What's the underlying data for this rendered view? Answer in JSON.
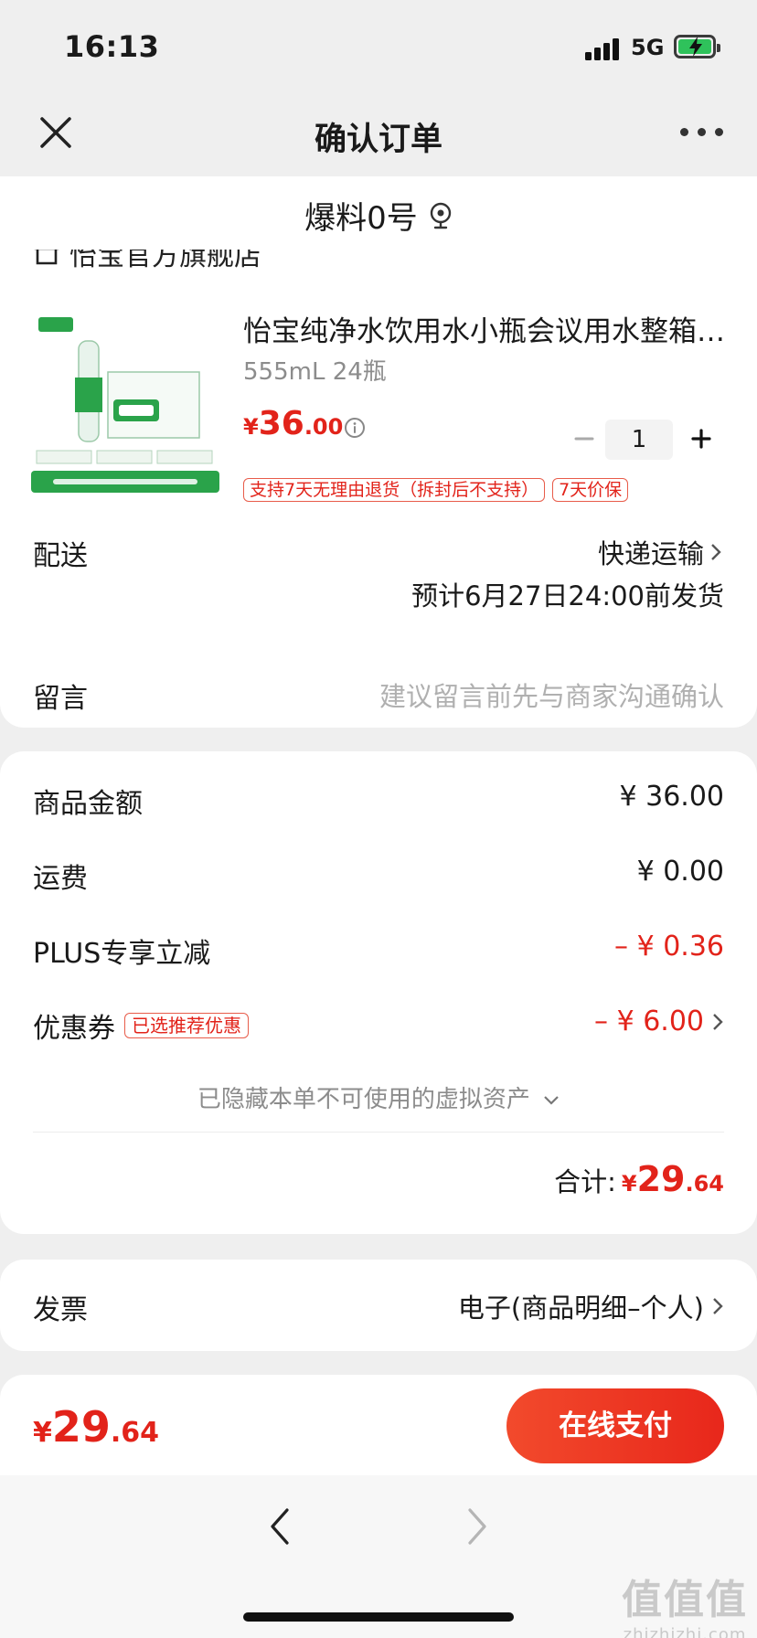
{
  "status_bar": {
    "time": "16:13",
    "network": "5G"
  },
  "nav": {
    "title": "确认订单"
  },
  "address": {
    "name": "爆料0号"
  },
  "shop": {
    "name": "怡宝官方旗舰店"
  },
  "product": {
    "title": "怡宝纯净水饮用水小瓶会议用水整箱…",
    "spec": "555mL 24瓶",
    "price_currency": "¥",
    "price_int": "36",
    "price_dec": ".00",
    "quantity": "1",
    "tags": [
      "支持7天无理由退货（拆封后不支持）",
      "7天价保"
    ]
  },
  "delivery": {
    "label": "配送",
    "method": "快递运输",
    "eta": "预计6月27日24:00前发货"
  },
  "message": {
    "label": "留言",
    "placeholder": "建议留言前先与商家沟通确认"
  },
  "summary": {
    "goods_label": "商品金额",
    "goods_value": "¥ 36.00",
    "shipping_label": "运费",
    "shipping_value": "¥ 0.00",
    "plus_label": "PLUS专享立减",
    "plus_value": "– ¥ 0.36",
    "coupon_label": "优惠券",
    "coupon_badge": "已选推荐优惠",
    "coupon_value": "– ¥ 6.00",
    "hidden_assets": "已隐藏本单不可使用的虚拟资产",
    "total_label": "合计:",
    "total_currency": "¥",
    "total_int": "29",
    "total_dec": ".64"
  },
  "invoice": {
    "label": "发票",
    "value": "电子(商品明细–个人)"
  },
  "pay": {
    "currency": "¥",
    "amount_int": "29",
    "amount_dec": ".64",
    "button": "在线支付"
  },
  "watermark": {
    "big": "值值值",
    "small": "zhizhizhi.com"
  },
  "colors": {
    "accent": "#e2231a",
    "pay_button": "#ee3a24",
    "background": "#efefef"
  }
}
